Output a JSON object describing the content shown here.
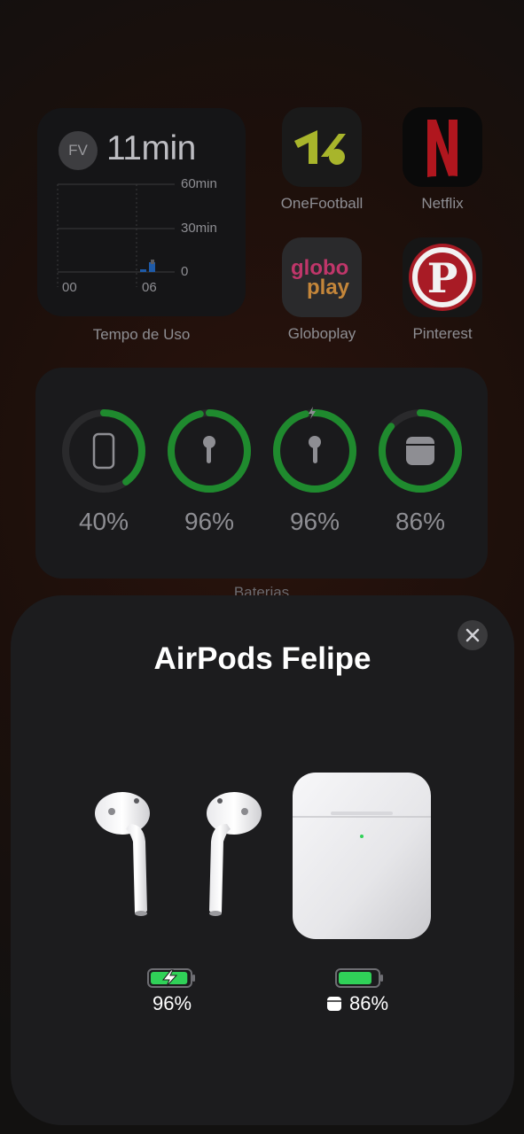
{
  "screen_time": {
    "avatar_initials": "FV",
    "total": "11min",
    "axis_labels": [
      "60min",
      "30min",
      "0"
    ],
    "time_labels": [
      "00",
      "06"
    ],
    "caption": "Tempo de Uso"
  },
  "apps": [
    {
      "label": "OneFootball",
      "icon": "onefootball-logo-icon"
    },
    {
      "label": "Netflix",
      "icon": "netflix-logo-icon"
    },
    {
      "label": "Globoplay",
      "icon": "globoplay-logo-icon"
    },
    {
      "label": "Pinterest",
      "icon": "pinterest-logo-icon"
    }
  ],
  "batteries": {
    "items": [
      {
        "device": "phone-icon",
        "percent": "40%",
        "level": 0.4
      },
      {
        "device": "airpod-left-icon",
        "percent": "96%",
        "level": 0.96
      },
      {
        "device": "airpod-right-icon",
        "percent": "96%",
        "level": 0.96,
        "charging": true
      },
      {
        "device": "airpods-case-icon",
        "percent": "86%",
        "level": 0.86
      }
    ],
    "caption": "Baterias",
    "ring_color": "#1f8a2e"
  },
  "airpods_sheet": {
    "title": "AirPods Felipe",
    "pods_battery": {
      "percent": "96%",
      "level": 0.96,
      "charging": true
    },
    "case_battery": {
      "percent": "86%",
      "level": 0.86
    },
    "battery_color": "#30d158"
  }
}
